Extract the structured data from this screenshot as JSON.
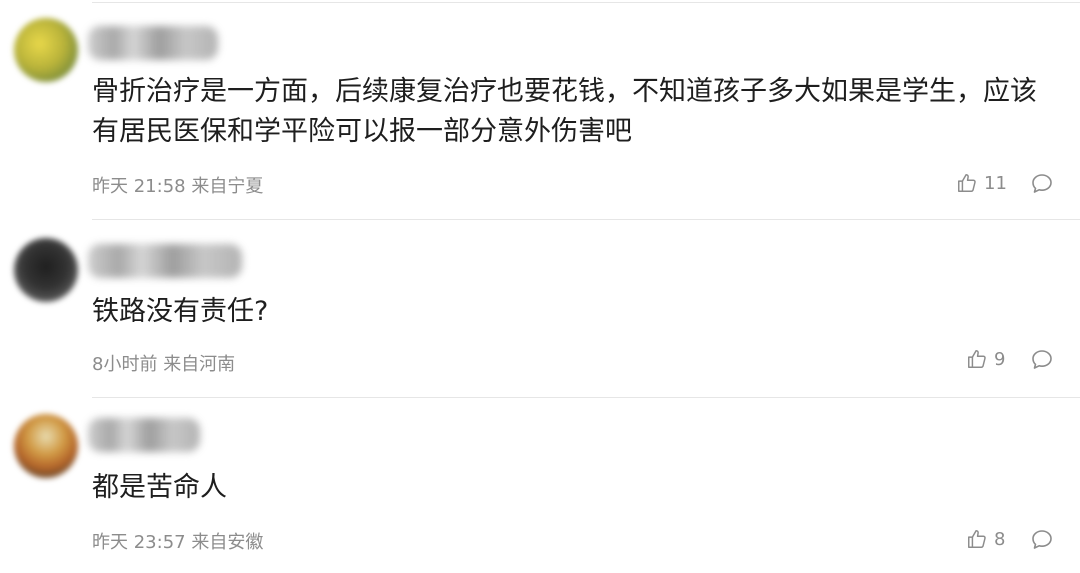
{
  "comments": [
    {
      "text": "骨折治疗是一方面，后续康复治疗也要花钱，不知道孩子多大如果是学生，应该有居民医保和学平险可以报一部分意外伤害吧",
      "time": "昨天 21:58",
      "location": "来自宁夏",
      "likes": "11"
    },
    {
      "text": "铁路没有责任?",
      "time": "8小时前",
      "location": "来自河南",
      "likes": "9"
    },
    {
      "text": "都是苦命人",
      "time": "昨天 23:57",
      "location": "来自安徽",
      "likes": "8"
    }
  ],
  "icons": {
    "like": "thumbs-up-icon",
    "reply": "comment-bubble-icon"
  },
  "colors": {
    "text": "#1e1e1e",
    "meta": "#8c8c8c",
    "divider": "#e6e6e6"
  }
}
